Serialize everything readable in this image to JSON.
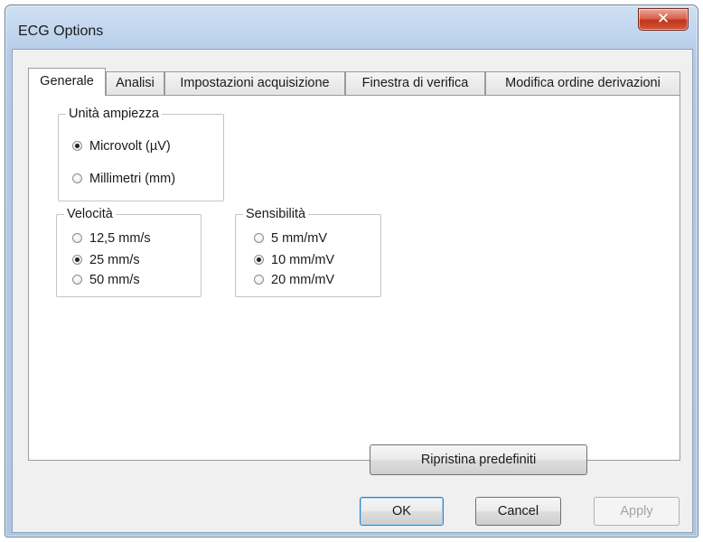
{
  "window": {
    "title": "ECG Options",
    "close_glyph": "✕"
  },
  "tabs": [
    {
      "label": "Generale",
      "active": true
    },
    {
      "label": "Analisi",
      "active": false
    },
    {
      "label": "Impostazioni acquisizione",
      "active": false
    },
    {
      "label": "Finestra di verifica",
      "active": false
    },
    {
      "label": "Modifica ordine derivazioni",
      "active": false
    }
  ],
  "amplitude_group": {
    "label": "Unità ampiezza",
    "options": [
      {
        "label": "Microvolt (µV)",
        "checked": true
      },
      {
        "label": "Millimetri (mm)",
        "checked": false
      }
    ]
  },
  "speed_group": {
    "label": "Velocità",
    "options": [
      {
        "label": "12,5 mm/s",
        "checked": false
      },
      {
        "label": "25 mm/s",
        "checked": true
      },
      {
        "label": "50 mm/s",
        "checked": false
      }
    ]
  },
  "sensitivity_group": {
    "label": "Sensibilità",
    "options": [
      {
        "label": "5 mm/mV",
        "checked": false
      },
      {
        "label": "10 mm/mV",
        "checked": true
      },
      {
        "label": "20 mm/mV",
        "checked": false
      }
    ]
  },
  "restore_button": {
    "label": "Ripristina predefiniti"
  },
  "footer": {
    "ok_label": "OK",
    "cancel_label": "Cancel",
    "apply_label": "Apply",
    "apply_enabled": false
  }
}
